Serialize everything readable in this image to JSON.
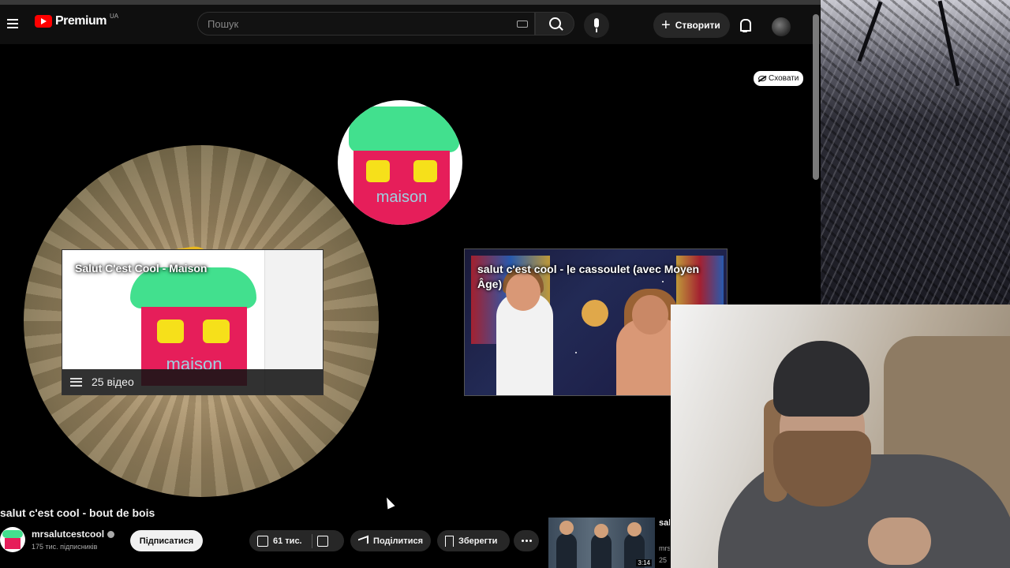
{
  "header": {
    "logo_text": "Premium",
    "logo_region": "UA",
    "search_placeholder": "Пошук",
    "create_label": "Створити"
  },
  "end_screen": {
    "hide_label": "Сховати",
    "playlist": {
      "title": "Salut C'est Cool - Maison",
      "drawing_text": "maison",
      "count_label": "25 відео"
    },
    "channel_logo_text": "maison",
    "video": {
      "title": "salut c'est cool - le cassoulet (avec Moyen Âge)"
    }
  },
  "video": {
    "title": "salut c'est cool - bout de bois",
    "channel_name": "mrsalutcestcool",
    "subscribers": "175 тис. підписників",
    "subscribe_label": "Підписатися",
    "likes": "61 тис.",
    "share_label": "Поділитися",
    "save_label": "Зберегти"
  },
  "recommended": {
    "title_fragment": "sal tou",
    "channel_fragment": "mrs",
    "meta_fragment": "25",
    "duration": "3:14"
  },
  "colors": {
    "brand_red": "#ff0000",
    "house_roof": "#42e08e",
    "house_wall": "#e61e5a",
    "house_window": "#f6e01a"
  }
}
